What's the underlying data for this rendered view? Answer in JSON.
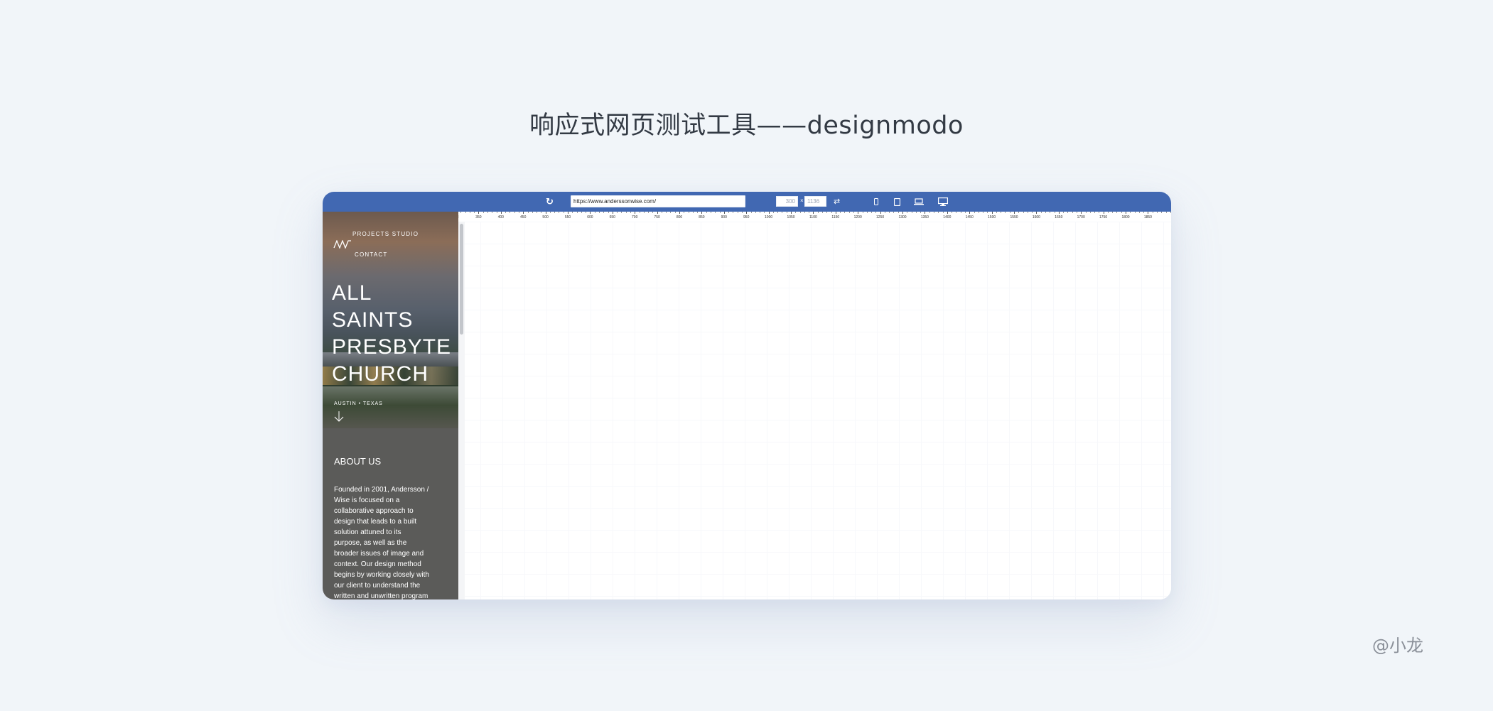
{
  "page": {
    "title": "响应式网页测试工具——designmodo",
    "watermark": "@小龙"
  },
  "toolbar": {
    "url": "https://www.anderssonwise.com/",
    "width_value": "300",
    "height_value": "1136",
    "dimension_separator": "×",
    "icons": [
      "refresh-icon",
      "rotate-icon",
      "phone-icon",
      "tablet-icon",
      "laptop-icon",
      "desktop-icon"
    ]
  },
  "ruler": {
    "labels": [
      "50",
      "100",
      "150",
      "200",
      "250",
      "300",
      "350",
      "400",
      "450",
      "500",
      "550",
      "600",
      "650",
      "700",
      "750",
      "800",
      "850",
      "900",
      "950",
      "1000",
      "1050",
      "1100",
      "1150",
      "1200",
      "1250",
      "1300",
      "1350",
      "1400",
      "1450",
      "1500",
      "1550",
      "1600",
      "1650",
      "1700",
      "1750",
      "1800",
      "1850",
      "1900"
    ]
  },
  "preview": {
    "nav_projects": "PROJECTS  STUDIO",
    "nav_contact": "CONTACT",
    "hero_lines": [
      "ALL",
      "SAINTS",
      "PRESBYTE",
      "CHURCH"
    ],
    "location": "AUSTIN • TEXAS",
    "about_heading": "ABOUT US",
    "about_lines": [
      "Founded in 2001, Andersson /",
      "Wise is focused on a",
      "collaborative approach to",
      "design that leads to a built",
      "solution attuned to its",
      "purpose, as well as the",
      "broader issues of image and",
      "context. Our design method",
      "begins by working closely with",
      "our client to understand the",
      "written and unwritten program"
    ]
  },
  "colors": {
    "toolbar": "#4168b2",
    "background": "#f1f5f9",
    "preview_bg": "#5b5b59"
  }
}
